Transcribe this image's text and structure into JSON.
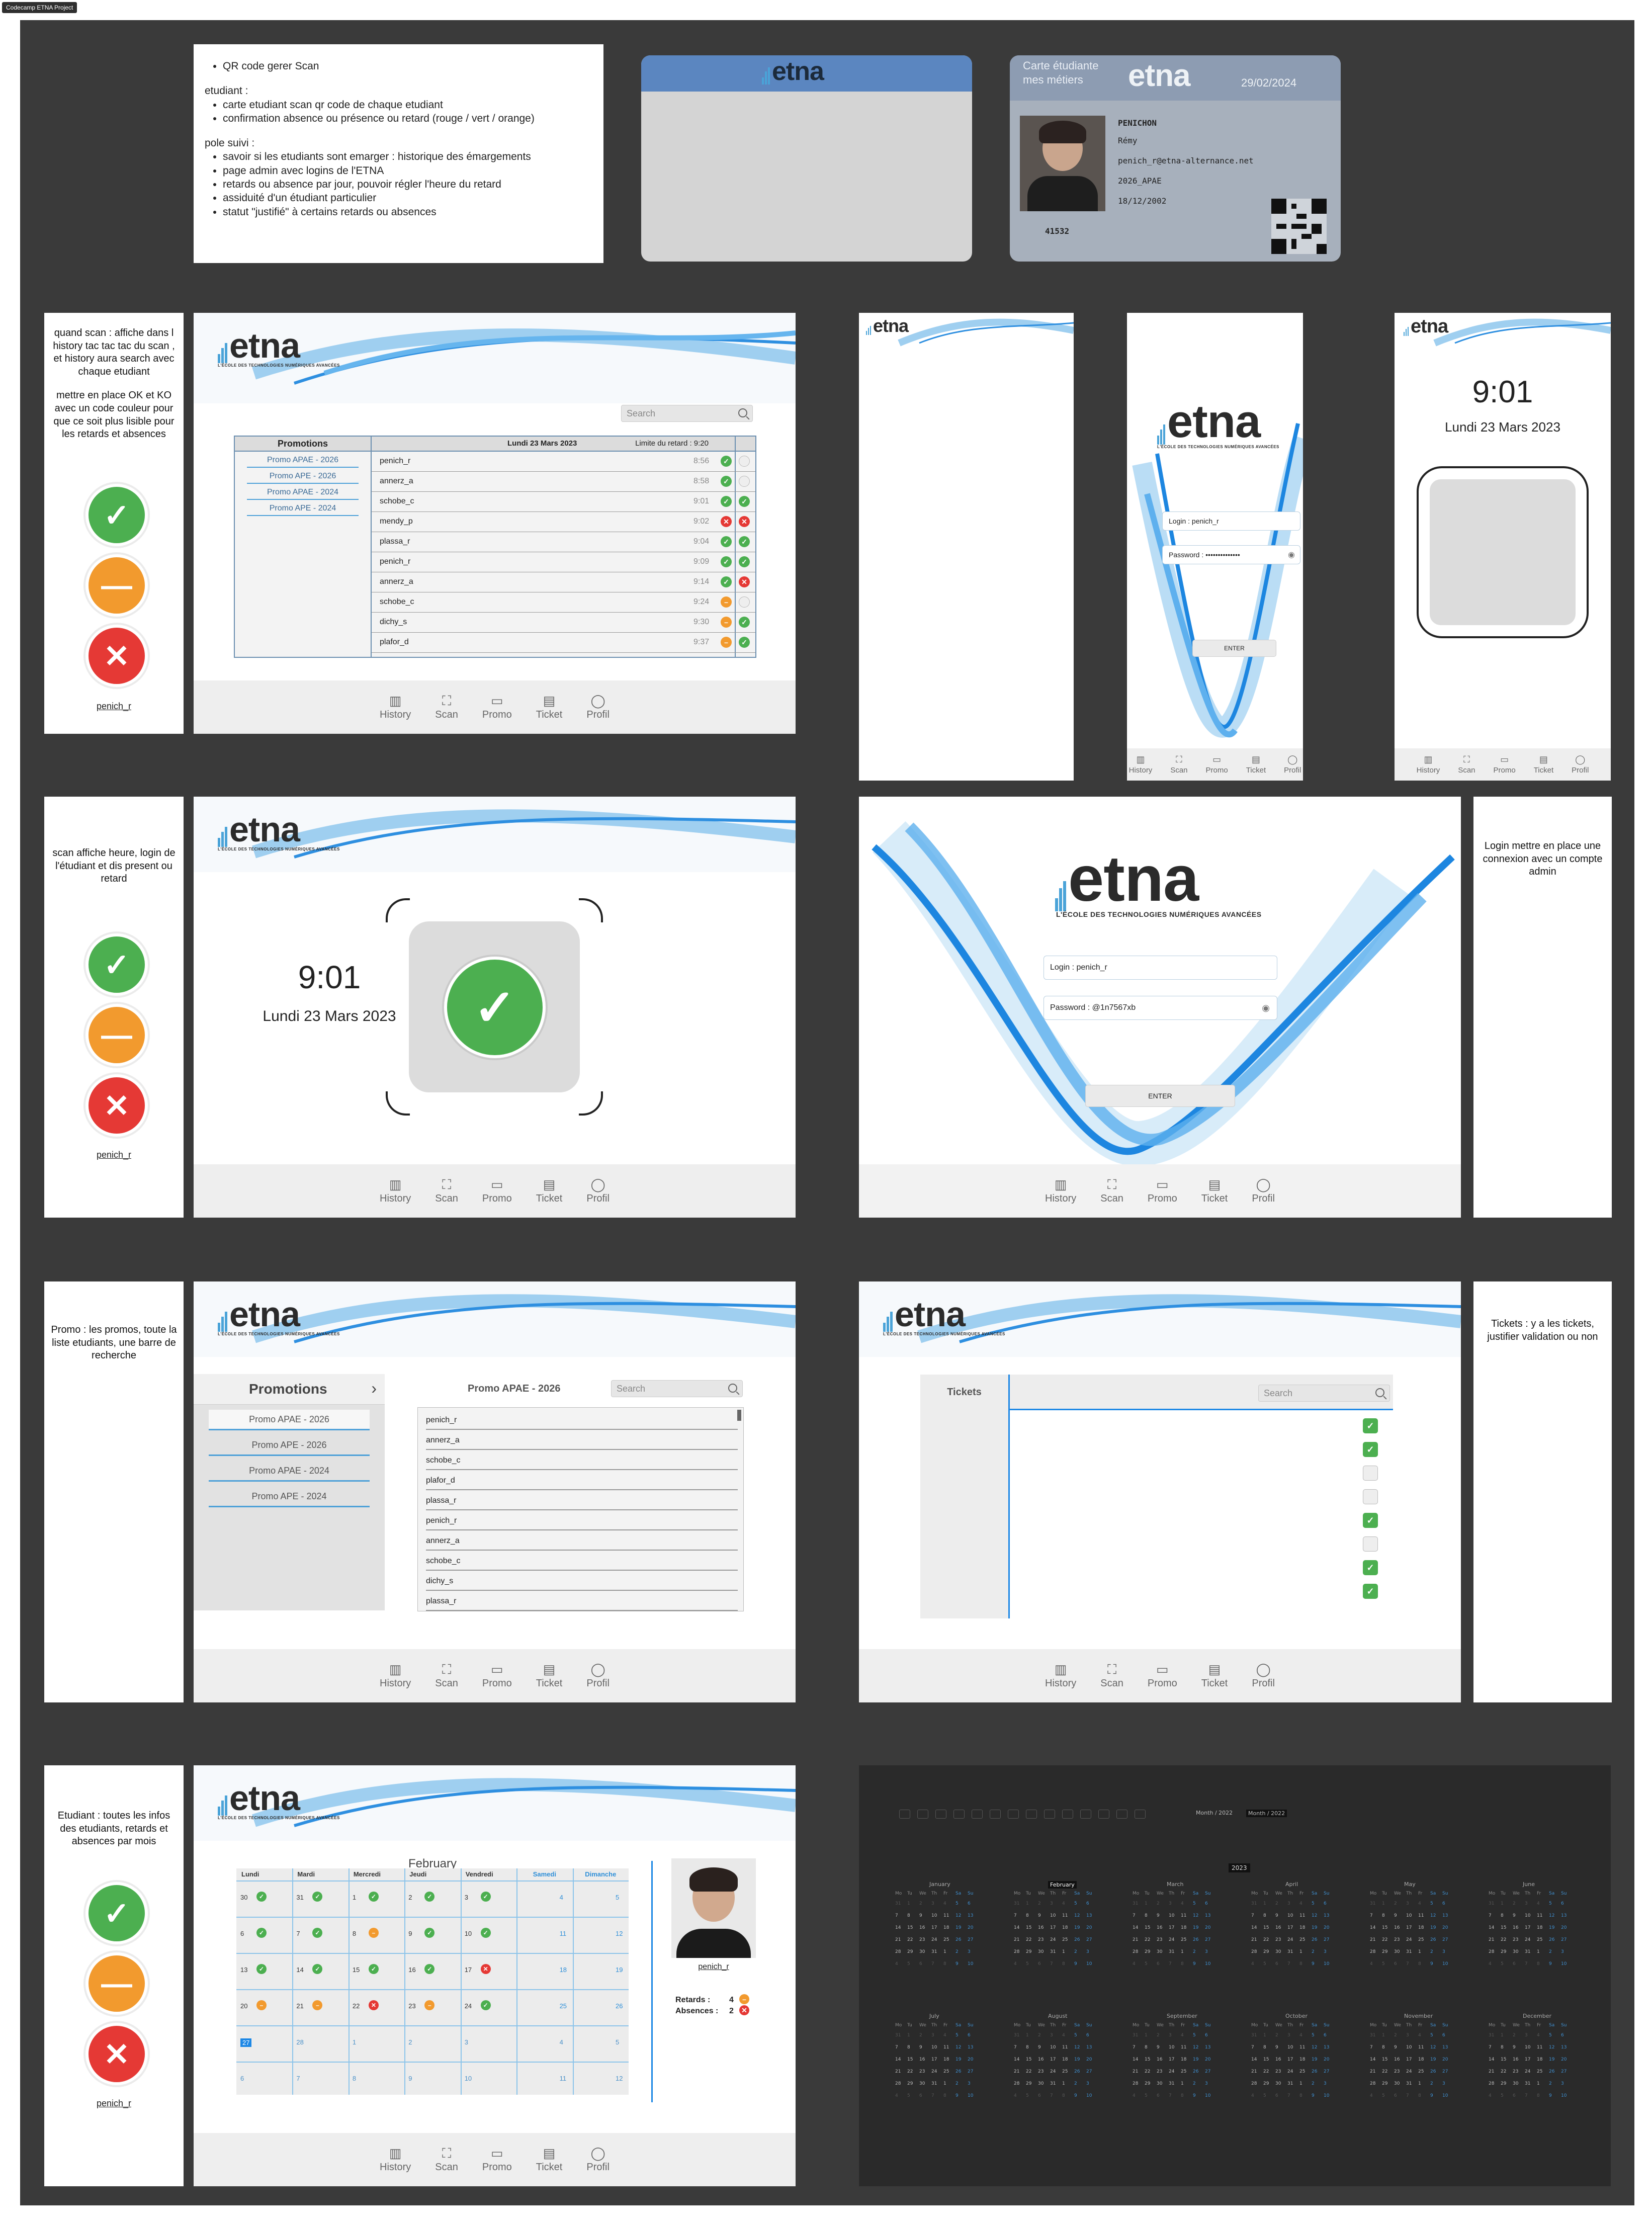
{
  "project_tag": "Codecamp ETNA Project",
  "brand": {
    "logo_word": "etna",
    "logo_subtitle": "L'ÉCOLE DES TECHNOLOGIES NUMÉRIQUES AVANCÉES",
    "blue": "#1e88e5",
    "ok_color": "#4caf50",
    "late_color": "#f29a2e",
    "ko_color": "#e53935"
  },
  "notes": {
    "intro_item": "QR code gerer Scan",
    "etudiant_title": "etudiant :",
    "etudiant_items": [
      "carte etudiant scan qr code de chaque etudiant",
      "confirmation absence ou présence ou retard (rouge / vert / orange)"
    ],
    "pole_title": "pole suivi :",
    "pole_items": [
      "savoir si les etudiants sont emarger : historique des émargements",
      "page admin avec logins de l'ETNA",
      "retards ou absence par jour, pouvoir régler l'heure du retard",
      "assiduité d'un étudiant particulier",
      "statut \"justifié\" à certains retards ou absences"
    ],
    "history_note_1": "quand scan : affiche dans l history tac tac tac du scan , et history aura search avec chaque etudiant",
    "history_note_2": "mettre en place OK et KO avec un code couleur pour que ce soit plus lisible pour les retards et absences",
    "scan_note": "scan affiche heure, login de l'étudiant et dis present ou retard",
    "login_note": "Login mettre en place une connexion avec un compte admin",
    "promo_note": "Promo : les promos, toute la liste etudiants, une barre de recherche",
    "tickets_note": "Tickets : y a les tickets, justifier validation ou non",
    "etudiant_note": "Etudiant : toutes les infos des etudiants, retards et absences par mois",
    "legend_user": "penich_r"
  },
  "card": {
    "title": "Carte étudiante",
    "subtitle": "mes métiers",
    "date": "29/02/2024",
    "name": "PENICHON",
    "firstname": "Rémy",
    "email": "penich_r@etna-alternance.net",
    "promo": "2026_APAE",
    "birth": "18/12/2002",
    "number": "41532"
  },
  "nav": {
    "items": [
      {
        "label": "History",
        "icon": "history-icon"
      },
      {
        "label": "Scan",
        "icon": "scan-icon"
      },
      {
        "label": "Promo",
        "icon": "folder-icon"
      },
      {
        "label": "Ticket",
        "icon": "ticket-icon"
      },
      {
        "label": "Profil",
        "icon": "profile-icon"
      }
    ]
  },
  "history": {
    "search_placeholder": "Search",
    "promos_header": "Promotions",
    "promos": [
      "Promo APAE - 2026",
      "Promo APE - 2026",
      "Promo APAE - 2024",
      "Promo APE - 2024"
    ],
    "date_header": "Lundi 23 Mars 2023",
    "limit_header": "Limite du retard : 9:20",
    "rows": [
      {
        "login": "penich_r",
        "time": "8:56",
        "a": "ok",
        "b": "empty"
      },
      {
        "login": "annerz_a",
        "time": "8:58",
        "a": "ok",
        "b": "empty"
      },
      {
        "login": "schobe_c",
        "time": "9:01",
        "a": "ok",
        "b": "ok"
      },
      {
        "login": "mendy_p",
        "time": "9:02",
        "a": "ko",
        "b": "ko"
      },
      {
        "login": "plassa_r",
        "time": "9:04",
        "a": "ok",
        "b": "ok"
      },
      {
        "login": "penich_r",
        "time": "9:09",
        "a": "ok",
        "b": "ok"
      },
      {
        "login": "annerz_a",
        "time": "9:14",
        "a": "ok",
        "b": "ko"
      },
      {
        "login": "schobe_c",
        "time": "9:24",
        "a": "late",
        "b": "empty"
      },
      {
        "login": "dichy_s",
        "time": "9:30",
        "a": "late",
        "b": "ok"
      },
      {
        "login": "plafor_d",
        "time": "9:37",
        "a": "late",
        "b": "ok"
      }
    ]
  },
  "mobile_login": {
    "login_value": "Login : penich_r",
    "password_value": "Password : ••••••••••••••",
    "enter_label": "ENTER"
  },
  "mobile_scan": {
    "time": "9:01",
    "date": "Lundi 23 Mars 2023"
  },
  "scan_screen": {
    "time": "9:01",
    "date": "Lundi 23 Mars 2023"
  },
  "login_screen": {
    "login_value": "Login : penich_r",
    "password_value": "Password : @1n7567xb",
    "enter_label": "ENTER"
  },
  "promo_screen": {
    "header": "Promotions",
    "promos": [
      "Promo APAE - 2026",
      "Promo APE - 2026",
      "Promo APAE - 2024",
      "Promo APE - 2024"
    ],
    "selected_title": "Promo APAE - 2026",
    "search_placeholder": "Search",
    "students": [
      "penich_r",
      "annerz_a",
      "schobe_c",
      "plafor_d",
      "plassa_r",
      "penich_r",
      "annerz_a",
      "schobe_c",
      "dichy_s",
      "plassa_r"
    ]
  },
  "tickets_screen": {
    "header": "Tickets",
    "search_placeholder": "Search",
    "checks": [
      true,
      true,
      false,
      false,
      true,
      false,
      true,
      true
    ]
  },
  "student_screen": {
    "month": "February",
    "weekdays": [
      "Lundi",
      "Mardi",
      "Mercredi",
      "Jeudi",
      "Vendredi",
      "Samedi",
      "Dimanche"
    ],
    "weeks": [
      [
        {
          "d": "30",
          "s": "ok"
        },
        {
          "d": "31",
          "s": "ok"
        },
        {
          "d": "1",
          "s": "ok"
        },
        {
          "d": "2",
          "s": "ok"
        },
        {
          "d": "3",
          "s": "ok"
        },
        {
          "d": "4",
          "s": ""
        },
        {
          "d": "5",
          "s": ""
        }
      ],
      [
        {
          "d": "6",
          "s": "ok"
        },
        {
          "d": "7",
          "s": "ok"
        },
        {
          "d": "8",
          "s": "late"
        },
        {
          "d": "9",
          "s": "ok"
        },
        {
          "d": "10",
          "s": "ok"
        },
        {
          "d": "11",
          "s": ""
        },
        {
          "d": "12",
          "s": ""
        }
      ],
      [
        {
          "d": "13",
          "s": "ok"
        },
        {
          "d": "14",
          "s": "ok"
        },
        {
          "d": "15",
          "s": "ok"
        },
        {
          "d": "16",
          "s": "ok"
        },
        {
          "d": "17",
          "s": "ko"
        },
        {
          "d": "18",
          "s": ""
        },
        {
          "d": "19",
          "s": ""
        }
      ],
      [
        {
          "d": "20",
          "s": "late"
        },
        {
          "d": "21",
          "s": "late"
        },
        {
          "d": "22",
          "s": "ko"
        },
        {
          "d": "23",
          "s": "late"
        },
        {
          "d": "24",
          "s": "ok"
        },
        {
          "d": "25",
          "s": ""
        },
        {
          "d": "26",
          "s": ""
        }
      ],
      [
        {
          "d": "27",
          "s": ""
        },
        {
          "d": "28",
          "s": ""
        },
        {
          "d": "1",
          "s": ""
        },
        {
          "d": "2",
          "s": ""
        },
        {
          "d": "3",
          "s": ""
        },
        {
          "d": "4",
          "s": ""
        },
        {
          "d": "5",
          "s": ""
        }
      ],
      [
        {
          "d": "6",
          "s": ""
        },
        {
          "d": "7",
          "s": ""
        },
        {
          "d": "8",
          "s": ""
        },
        {
          "d": "9",
          "s": ""
        },
        {
          "d": "10",
          "s": ""
        },
        {
          "d": "11",
          "s": ""
        },
        {
          "d": "12",
          "s": ""
        }
      ]
    ],
    "student_login": "penich_r",
    "retards_label": "Retards :",
    "retards_value": "4",
    "absences_label": "Absences :",
    "absences_value": "2"
  },
  "dark_calendar": {
    "year": "2023",
    "toolbar": [
      "Month / 2022",
      "Month / 2022"
    ],
    "months": [
      "January",
      "February",
      "March",
      "April",
      "May",
      "June",
      "July",
      "August",
      "September",
      "October",
      "November",
      "December"
    ],
    "weekdays": [
      "Mo",
      "Tu",
      "We",
      "Th",
      "Fr",
      "Sa",
      "Su"
    ]
  }
}
